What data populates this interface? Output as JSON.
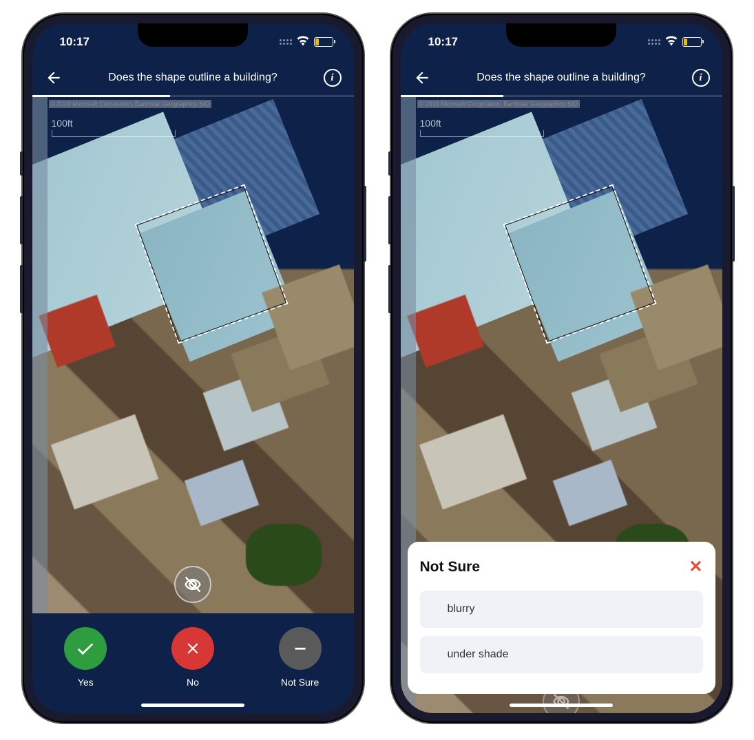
{
  "status": {
    "time": "10:17"
  },
  "nav": {
    "title": "Does the shape outline a building?"
  },
  "map": {
    "attribution": "© 2019 Microsoft Corporation, Earthstar Geographics SIO",
    "scale_label": "100ft"
  },
  "progress": {
    "percent_left": 43,
    "percent_right": 32
  },
  "actions": {
    "yes": "Yes",
    "no": "No",
    "not_sure": "Not Sure"
  },
  "sheet": {
    "title": "Not Sure",
    "options": [
      "blurry",
      "under shade"
    ]
  }
}
